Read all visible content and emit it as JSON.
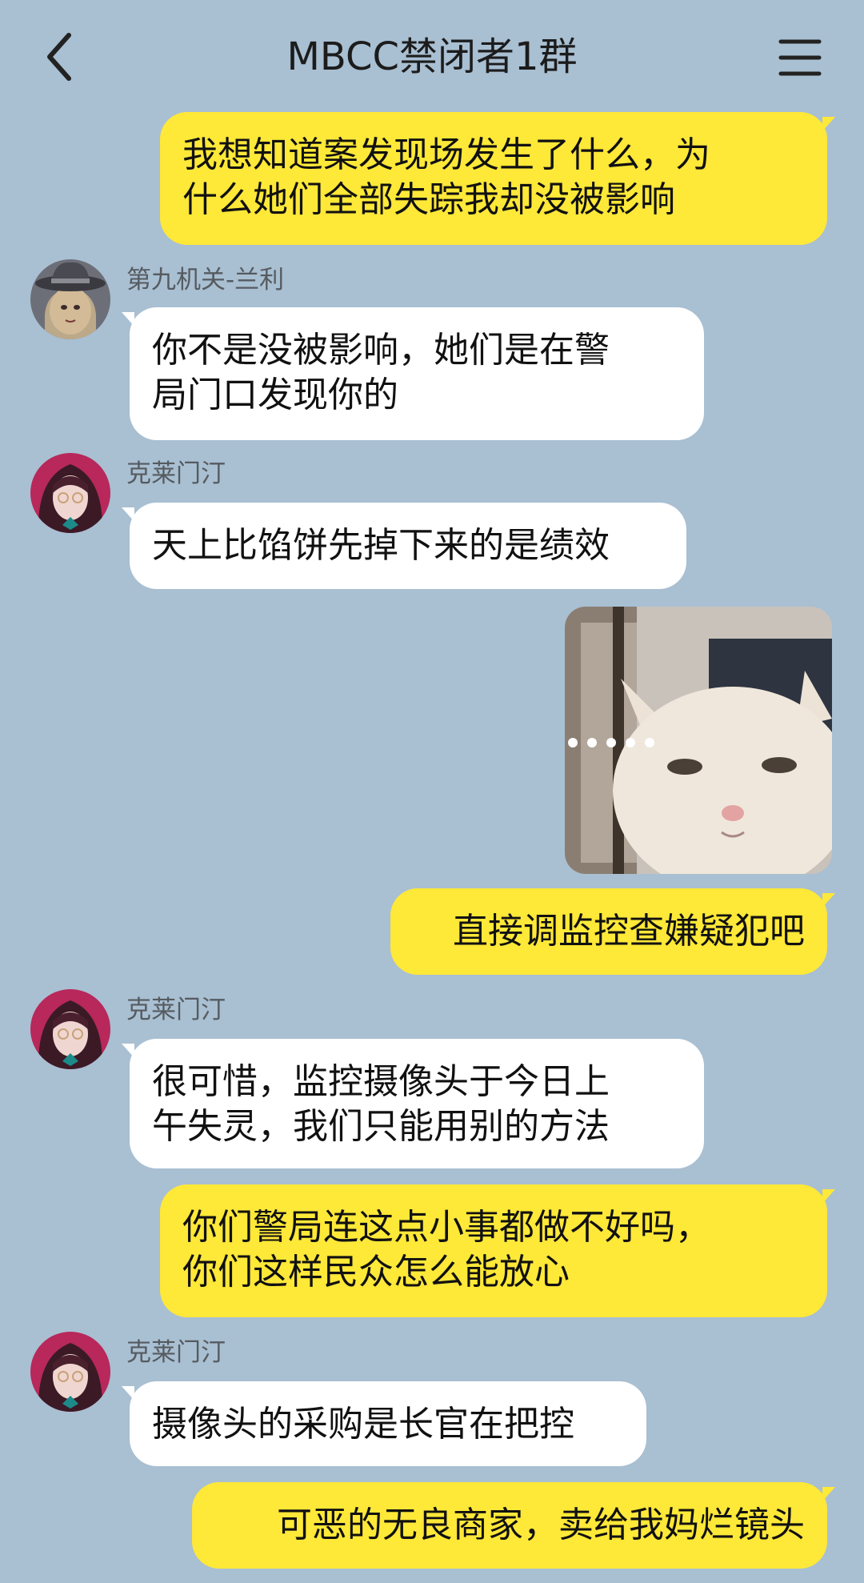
{
  "header": {
    "title": "MBCC禁闭者1群",
    "back_icon": "chevron-left-icon",
    "menu_icon": "hamburger-menu-icon"
  },
  "messages": [
    {
      "direction": "out",
      "text": "我想知道案发现场发生了什么，为\n什么她们全部失踪我却没被影响"
    },
    {
      "direction": "in",
      "sender": "第九机关-兰利",
      "text": "你不是没被影响，她们是在警\n局门口发现你的"
    },
    {
      "direction": "in",
      "sender": "克莱门汀",
      "text": "天上比馅饼先掉下来的是绩效"
    },
    {
      "direction": "out",
      "type": "image",
      "image": "cat-meme-image"
    },
    {
      "direction": "out",
      "text": "直接调监控查嫌疑犯吧"
    },
    {
      "direction": "in",
      "sender": "克莱门汀",
      "text": "很可惜，监控摄像头于今日上\n午失灵，我们只能用别的方法"
    },
    {
      "direction": "out",
      "text": "你们警局连这点小事都做不好吗，\n你们这样民众怎么能放心"
    },
    {
      "direction": "in",
      "sender": "克莱门汀",
      "text": "摄像头的采购是长官在把控"
    },
    {
      "direction": "out",
      "text": "可恶的无良商家，卖给我妈烂镜头"
    }
  ],
  "colors": {
    "background": "#a9bfd2",
    "outgoing_bubble": "#fee838",
    "incoming_bubble": "#ffffff"
  }
}
